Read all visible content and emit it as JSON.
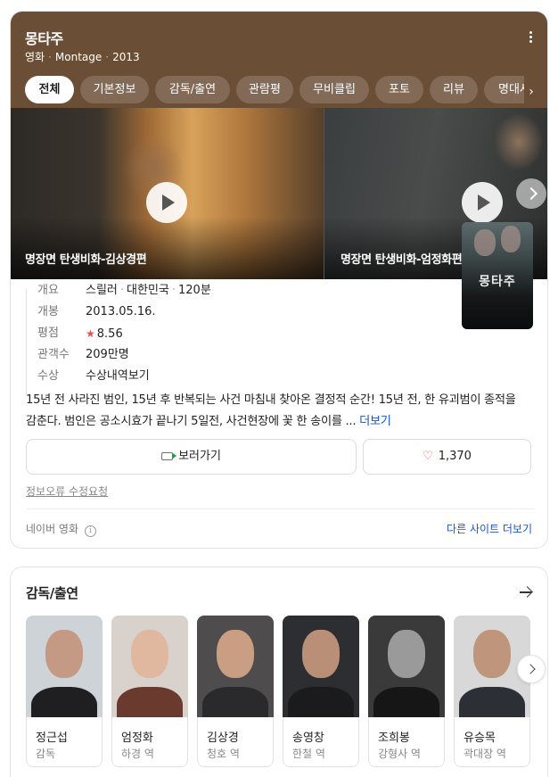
{
  "movie": {
    "title": "몽타주",
    "genre_type": "영화",
    "english_title": "Montage",
    "year": "2013"
  },
  "tabs": [
    "전체",
    "기본정보",
    "감독/출연",
    "관람평",
    "무비클립",
    "포토",
    "리뷰",
    "명대사"
  ],
  "videos": [
    {
      "caption": "명장면 탄생비화-김상경편"
    },
    {
      "caption": "명장면 탄생비화-엄정화편"
    }
  ],
  "poster": {
    "title": "몽타주"
  },
  "info": {
    "overview_label": "개요",
    "overview_genre": "스릴러",
    "overview_country": "대한민국",
    "overview_runtime": "120분",
    "release_label": "개봉",
    "release_value": "2013.05.16.",
    "rating_label": "평점",
    "rating_value": "8.56",
    "audience_label": "관객수",
    "audience_value": "209만명",
    "awards_label": "수상",
    "awards_link": "수상내역보기"
  },
  "synopsis": {
    "text": "15년 전 사라진 범인, 15년 후 반복되는 사건 마침내 찾아온 결정적 순간! 15년 전, 한 유괴범이 종적을 감춘다. 범인은 공소시효가 끝나기 5일전, 사건현장에 꽃 한 송이를 ...",
    "more": "더보기"
  },
  "actions": {
    "watch_label": "보러가기",
    "like_count": "1,370"
  },
  "footer": {
    "report_link": "정보오류 수정요청",
    "source": "네이버 영화",
    "other_sites": "다른 사이트 더보기"
  },
  "cast_section": {
    "title": "감독/출연",
    "people": [
      {
        "name": "정근섭",
        "role": "감독"
      },
      {
        "name": "엄정화",
        "role": "하경 역"
      },
      {
        "name": "김상경",
        "role": "청호 역"
      },
      {
        "name": "송영창",
        "role": "한철 역"
      },
      {
        "name": "조희봉",
        "role": "강형사 역"
      },
      {
        "name": "유승목",
        "role": "곽대장 역"
      }
    ]
  },
  "colors": {
    "hero_bg": "#6b4e36",
    "link": "#1a55c8",
    "star": "#f24d4d",
    "watch_icon": "#1aa33b",
    "heart": "#e24a4a"
  },
  "icons": [
    "more-vertical-icon",
    "chevron-right-icon",
    "play-icon",
    "star-icon",
    "video-camera-icon",
    "heart-icon",
    "info-icon",
    "arrow-right-icon"
  ]
}
